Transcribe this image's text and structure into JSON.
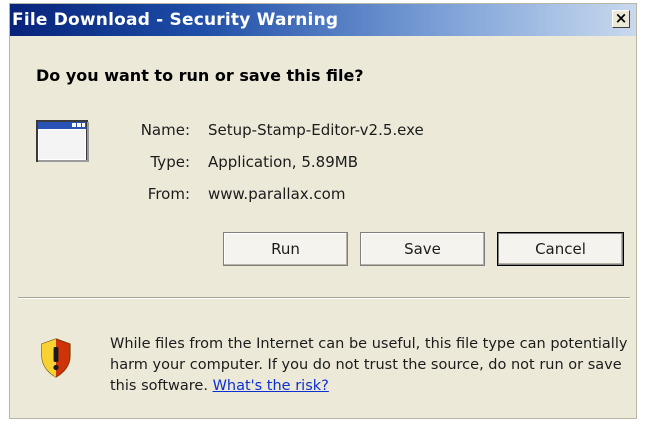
{
  "window": {
    "title": "File Download - Security Warning",
    "close_glyph": "×",
    "icons": {
      "close": "close-icon",
      "file": "application-window-icon",
      "warning": "shield-warning-icon"
    }
  },
  "prompt": {
    "question": "Do you want to run or save this file?"
  },
  "file_info": {
    "name_label": "Name:",
    "name_value": "Setup-Stamp-Editor-v2.5.exe",
    "type_label": "Type:",
    "type_value": "Application, 5.89MB",
    "from_label": "From:",
    "from_value": "www.parallax.com"
  },
  "buttons": {
    "run": "Run",
    "save": "Save",
    "cancel": "Cancel"
  },
  "warning": {
    "text": "While files from the Internet can be useful, this file type can potentially harm your computer. If you do not trust the source, do not run or save this software.",
    "link": "What's the risk?"
  },
  "colors": {
    "title_bar_start": "#07237a",
    "dialog_bg": "#ece9d8",
    "link": "#0b2fd1",
    "shield_yellow": "#f2c400",
    "shield_red": "#c81a0a"
  }
}
